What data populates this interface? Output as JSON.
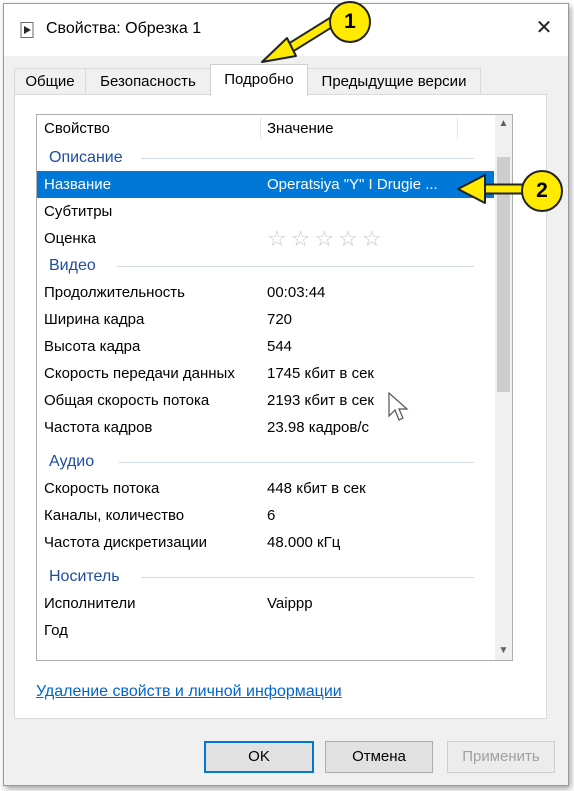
{
  "window": {
    "title": "Свойства: Обрезка 1"
  },
  "tabs": [
    "Общие",
    "Безопасность",
    "Подробно",
    "Предыдущие версии"
  ],
  "list": {
    "header": {
      "property": "Свойство",
      "value": "Значение"
    },
    "groups": {
      "description": {
        "title": "Описание",
        "rows": [
          {
            "k": "Название",
            "v": "Operatsiya \"Y\" I Drugie ..."
          },
          {
            "k": "Субтитры",
            "v": ""
          },
          {
            "k": "Оценка",
            "v": ""
          }
        ]
      },
      "video": {
        "title": "Видео",
        "rows": [
          {
            "k": "Продолжительность",
            "v": "00:03:44"
          },
          {
            "k": "Ширина кадра",
            "v": "720"
          },
          {
            "k": "Высота кадра",
            "v": "544"
          },
          {
            "k": "Скорость передачи данных",
            "v": "1745 кбит в сек"
          },
          {
            "k": "Общая скорость потока",
            "v": "2193 кбит в сек"
          },
          {
            "k": "Частота кадров",
            "v": "23.98 кадров/с"
          }
        ]
      },
      "audio": {
        "title": "Аудио",
        "rows": [
          {
            "k": "Скорость потока",
            "v": "448 кбит в сек"
          },
          {
            "k": "Каналы, количество",
            "v": "6"
          },
          {
            "k": "Частота дискретизации",
            "v": "48.000 кГц"
          }
        ]
      },
      "media": {
        "title": "Носитель",
        "rows": [
          {
            "k": "Исполнители",
            "v": "Vaippp"
          },
          {
            "k": "Год",
            "v": ""
          }
        ]
      }
    },
    "rating_stars": "☆☆☆☆☆"
  },
  "link": "Удаление свойств и личной информации",
  "buttons": {
    "ok": "OK",
    "cancel": "Отмена",
    "apply": "Применить"
  },
  "callouts": {
    "one": "1",
    "two": "2"
  },
  "colors": {
    "selection": "#0078d7",
    "group": "#1e4ca0",
    "link": "#0066cc",
    "callout": "#ffea00"
  }
}
